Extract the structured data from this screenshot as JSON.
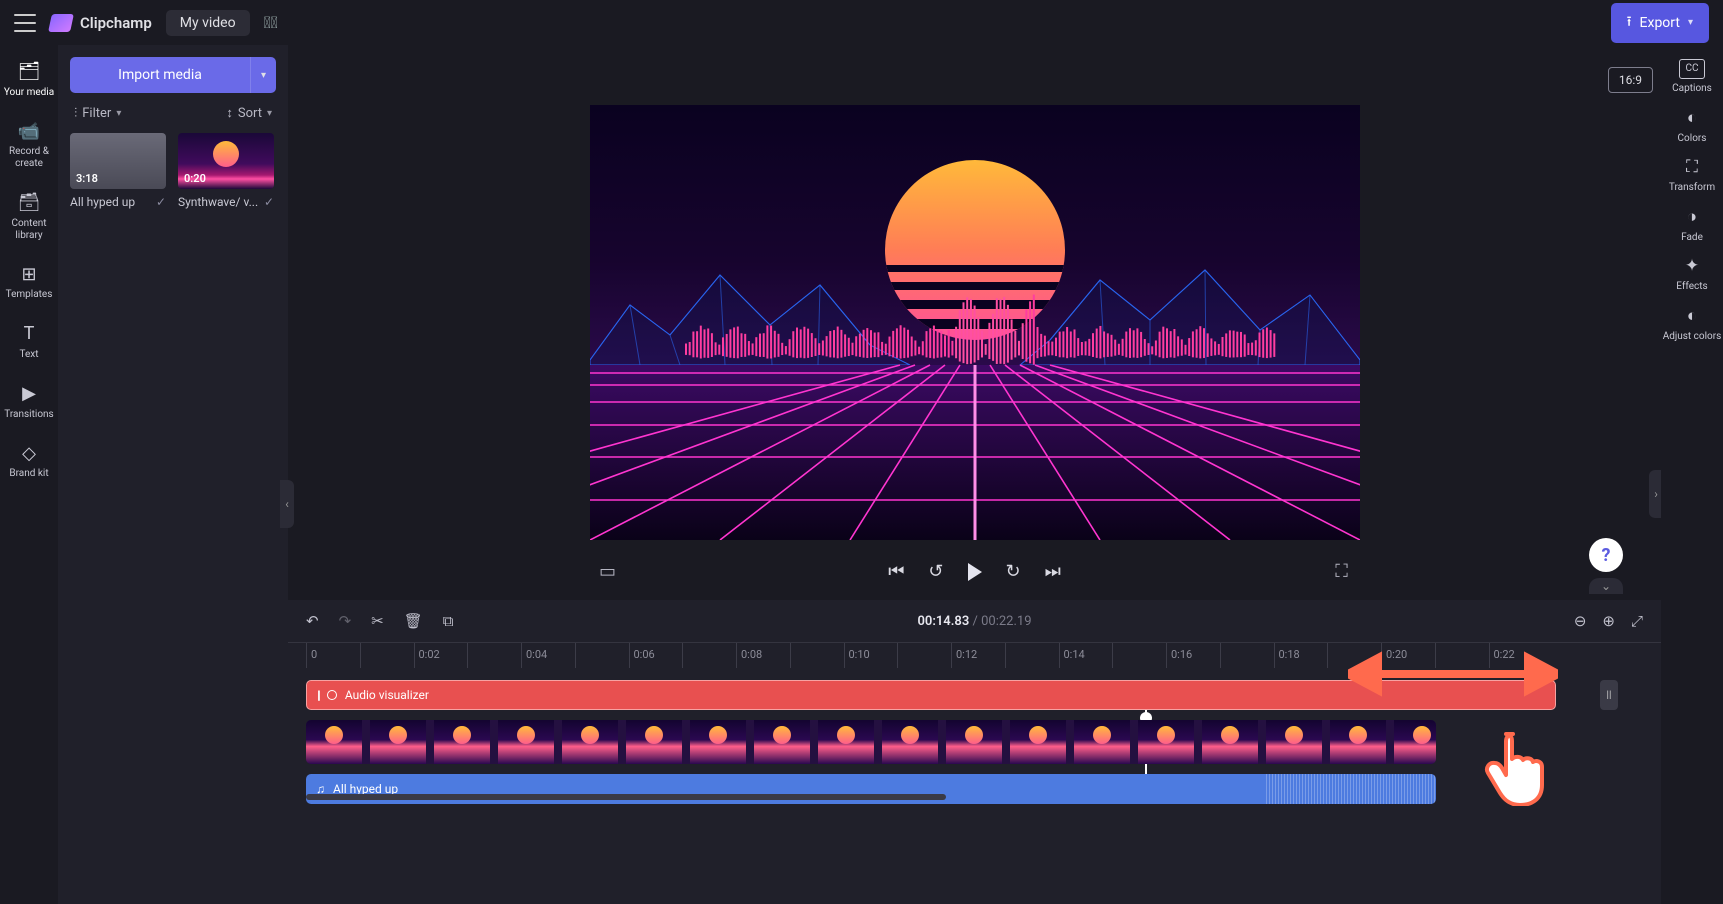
{
  "topbar": {
    "brand": "Clipchamp",
    "project_name": "My video",
    "export_label": "Export"
  },
  "left_rail": [
    {
      "icon": "🗂",
      "label": "Your media"
    },
    {
      "icon": "📹",
      "label": "Record & create"
    },
    {
      "icon": "🗃",
      "label": "Content library"
    },
    {
      "icon": "⊞",
      "label": "Templates"
    },
    {
      "icon": "T",
      "label": "Text"
    },
    {
      "icon": "▶",
      "label": "Transitions"
    },
    {
      "icon": "◇",
      "label": "Brand kit"
    }
  ],
  "media_panel": {
    "import_label": "Import media",
    "filter_label": "Filter",
    "sort_label": "Sort",
    "items": [
      {
        "duration": "3:18",
        "title": "All hyped up"
      },
      {
        "duration": "0:20",
        "title": "Synthwave/ v..."
      }
    ]
  },
  "right_rail": [
    {
      "icon": "CC",
      "label": "Captions",
      "boxed": true
    },
    {
      "icon": "◐",
      "label": "Colors"
    },
    {
      "icon": "⛶",
      "label": "Transform"
    },
    {
      "icon": "◑",
      "label": "Fade"
    },
    {
      "icon": "✦",
      "label": "Effects"
    },
    {
      "icon": "◐",
      "label": "Adjust colors"
    }
  ],
  "stage": {
    "aspect_label": "16:9"
  },
  "timeline": {
    "current": "00:14.83",
    "sep": " / ",
    "total": "00:22.19",
    "ticks": [
      "0",
      "0:02",
      "0:04",
      "0:06",
      "0:08",
      "0:10",
      "0:12",
      "0:14",
      "0:16",
      "0:18",
      "0:20",
      "0:22"
    ],
    "visualizer_clip_label": "Audio visualizer",
    "audio_clip_label": "All hyped up"
  },
  "help": {
    "label": "?"
  }
}
